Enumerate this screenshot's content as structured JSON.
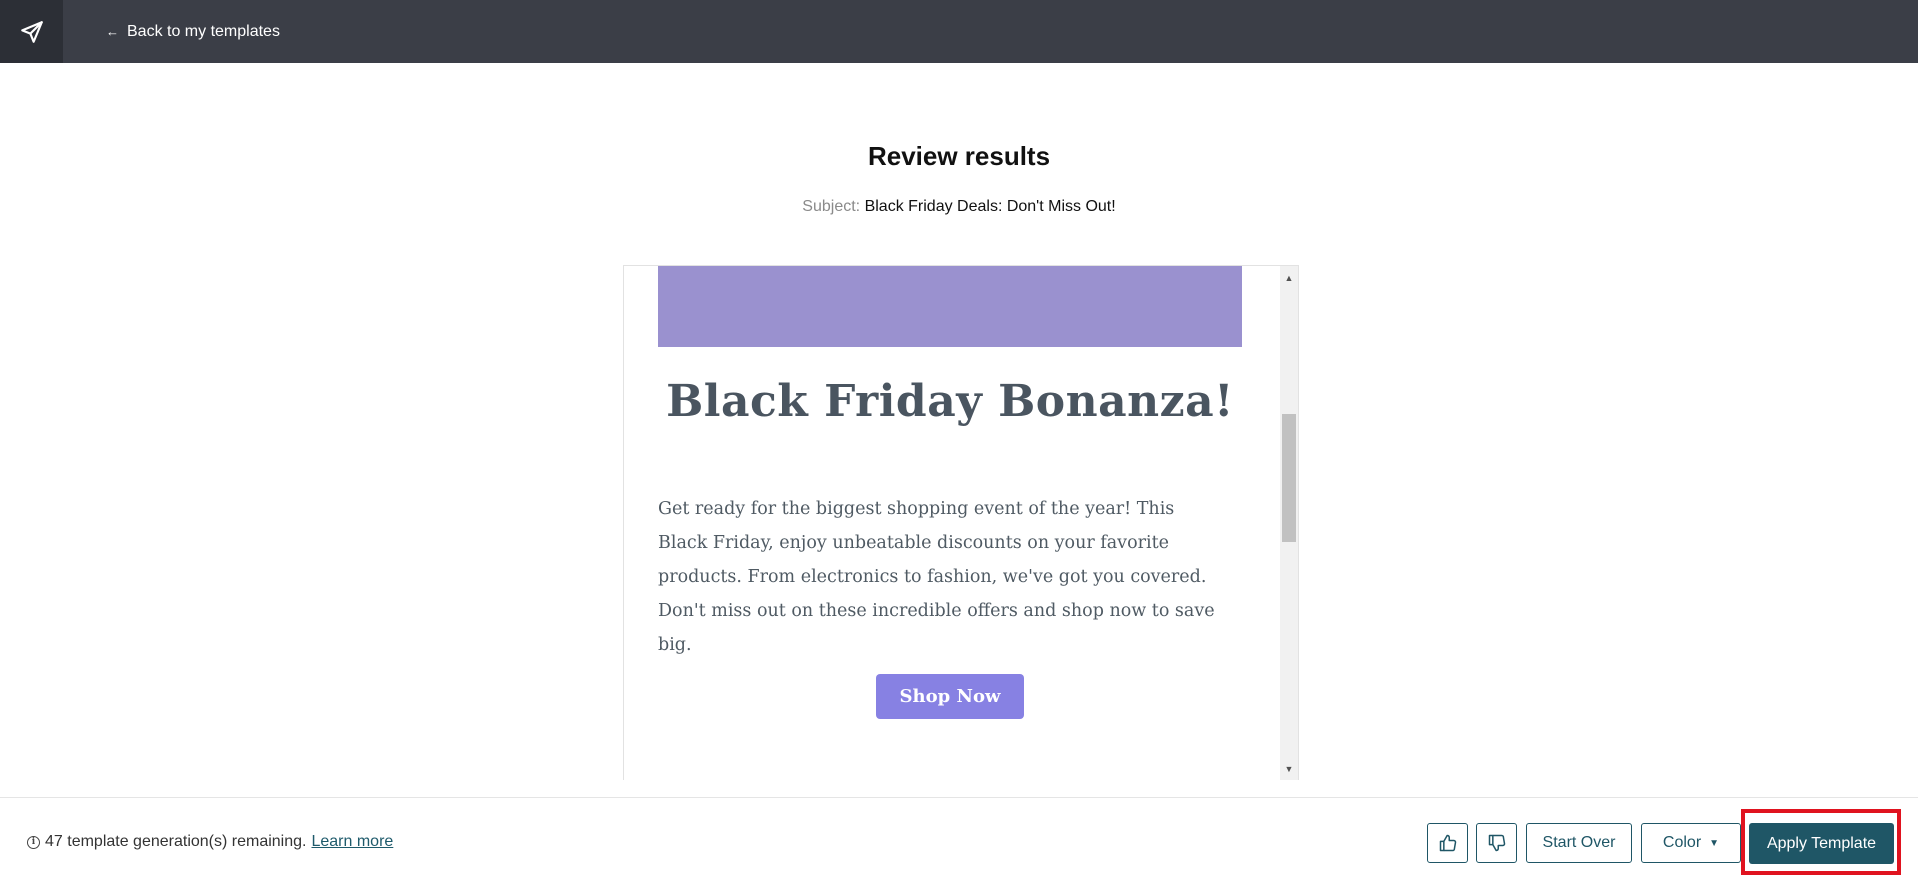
{
  "topbar": {
    "logo_icon": "paper-plane-icon",
    "back_arrow": "←",
    "back_label": "Back to my templates"
  },
  "review": {
    "title": "Review results",
    "subject_label": "Subject:",
    "subject_value": "Black Friday Deals: Don't Miss Out!"
  },
  "email": {
    "banner_color": "#9a91cf",
    "heading": "Black Friday Bonanza!",
    "body": "Get ready for the biggest shopping event of the year! This Black Friday, enjoy unbeatable discounts on your favorite products. From electronics to fashion, we've got you covered. Don't miss out on these incredible offers and shop now to save big.",
    "button_label": "Shop Now",
    "button_color": "#8781e3"
  },
  "footer": {
    "info_icon": "info-icon",
    "remaining_text": "47 template generation(s) remaining.",
    "learn_more": "Learn more",
    "thumbs_up_icon": "thumbs-up-icon",
    "thumbs_down_icon": "thumbs-down-icon",
    "start_over": "Start Over",
    "color_label": "Color",
    "apply_label": "Apply Template",
    "accent_color": "#1f5666",
    "highlight_color": "#e0131f"
  }
}
